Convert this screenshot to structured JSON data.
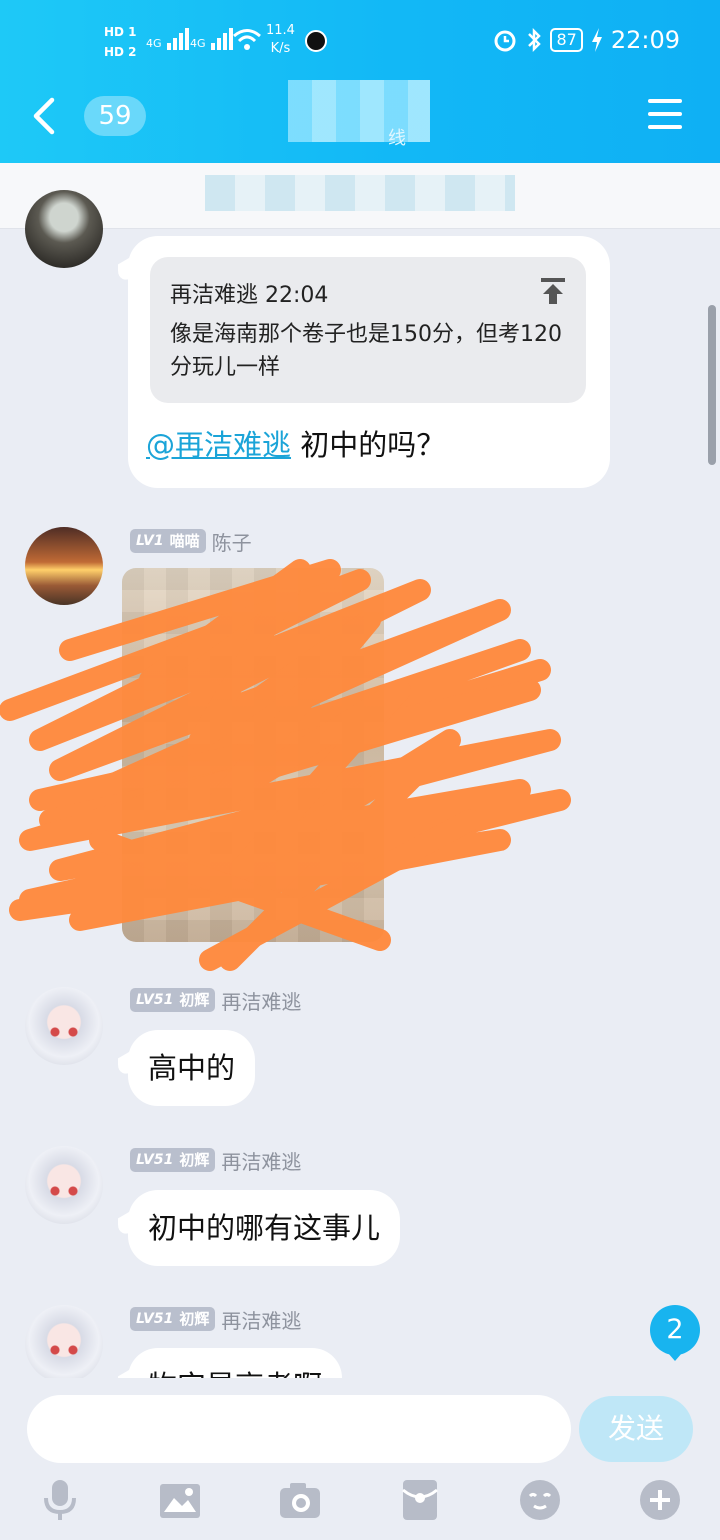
{
  "status_bar": {
    "sim1": "HD 1",
    "sim2": "HD 2",
    "signal1": "4G",
    "signal2": "4G",
    "net_speed_value": "11.4",
    "net_speed_unit": "K/s",
    "battery": "87",
    "time": "22:09"
  },
  "header": {
    "unread_count": "59",
    "subtitle_fragment": "线"
  },
  "messages": {
    "m1": {
      "quote_header": "再洁难逃 22:04",
      "quote_text": "像是海南那个卷子也是150分，但考120分玩儿一样",
      "mention": "@再洁难逃",
      "text": "初中的吗？"
    },
    "m2": {
      "level": "LV1",
      "title": "喵喵",
      "name": "陈子"
    },
    "m3": {
      "level": "LV51",
      "title": "初辉",
      "name": "再洁难逃",
      "text": "高中的"
    },
    "m4": {
      "level": "LV51",
      "title": "初辉",
      "name": "再洁难逃",
      "text": "初中的哪有这事儿"
    },
    "m5": {
      "level": "LV51",
      "title": "初辉",
      "name": "再洁难逃",
      "text": "物实是高考啊"
    }
  },
  "new_message_badge": "2",
  "composer": {
    "placeholder": "",
    "send_label": "发送"
  },
  "toolbar_icons": [
    "microphone-icon",
    "image-icon",
    "camera-icon",
    "red-packet-icon",
    "emoji-icon",
    "plus-icon"
  ],
  "colors": {
    "header_gradient_start": "#1ec9f7",
    "header_gradient_end": "#0fb0f4",
    "mention": "#1ba4d8",
    "background": "#eaedf4",
    "scribble": "#ff8a3d"
  }
}
